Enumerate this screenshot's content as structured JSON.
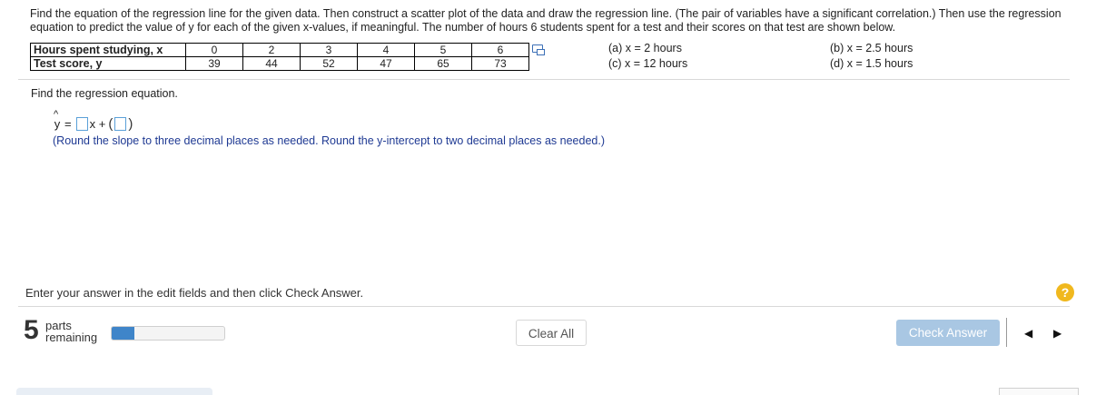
{
  "problem": {
    "text": "Find the equation of the regression line for the given data. Then construct a scatter plot of the data and draw the regression line. (The pair of variables have a significant correlation.) Then use the regression equation to predict the value of y for each of the given x-values, if meaningful. The number of hours 6 students spent for a test and their scores on that test are shown below."
  },
  "table": {
    "row1_label": "Hours spent studying, x",
    "row1_values": [
      "0",
      "2",
      "3",
      "4",
      "5",
      "6"
    ],
    "row2_label": "Test score, y",
    "row2_values": [
      "39",
      "44",
      "52",
      "47",
      "65",
      "73"
    ]
  },
  "parts": {
    "a": "(a) x = 2 hours",
    "b": "(b) x = 2.5 hours",
    "c": "(c) x = 12 hours",
    "d": "(d) x = 1.5 hours"
  },
  "question": {
    "prompt": "Find the regression equation.",
    "yhat": "y",
    "hat": "^",
    "equals": "=",
    "x_plus": "x +",
    "paren_open": "(",
    "paren_close": ")",
    "hint": "(Round the slope to three decimal places as needed. Round the y-intercept to two decimal places as needed.)",
    "slope_value": "",
    "intercept_value": ""
  },
  "footer": {
    "instruction": "Enter your answer in the edit fields and then click Check Answer.",
    "help": "?",
    "parts_count": "5",
    "parts_label_1": "parts",
    "parts_label_2": "remaining",
    "progress_fraction": 0.2,
    "clear_all": "Clear All",
    "check_answer": "Check Answer",
    "prev": "◀",
    "next": "▶"
  },
  "colors": {
    "accent": "#3f85c9",
    "check_disabled": "#a9c7e3",
    "help": "#f0b81e",
    "hint_text": "#1f3a93"
  }
}
